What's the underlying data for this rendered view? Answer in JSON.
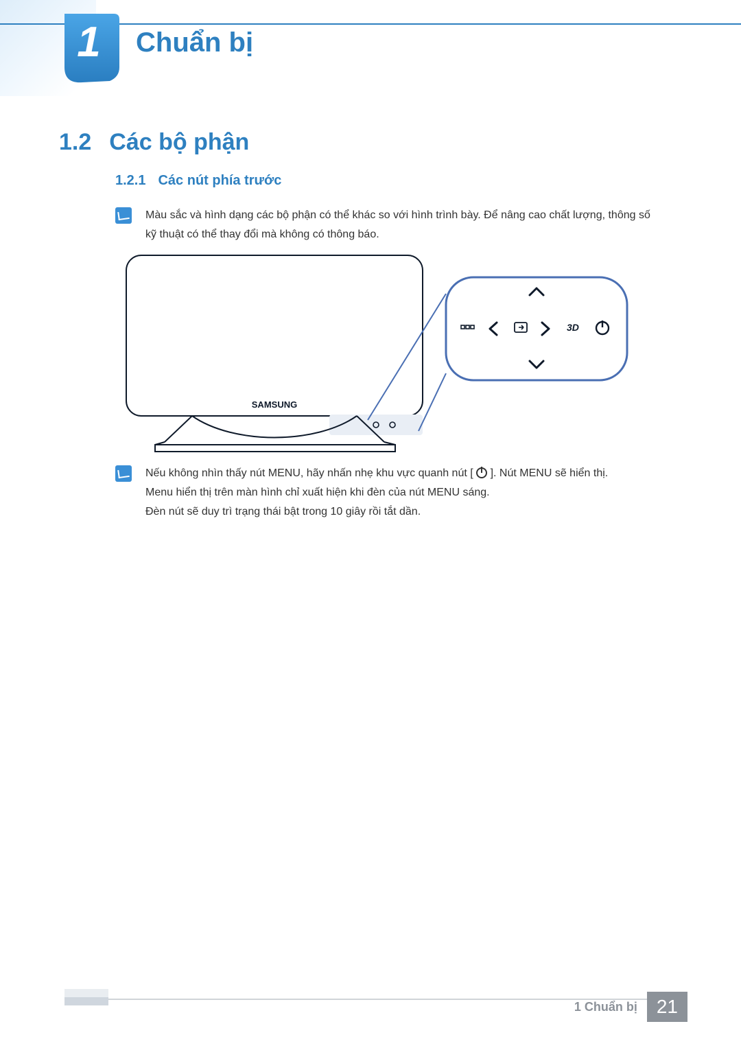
{
  "chapter": {
    "number": "1",
    "title": "Chuẩn bị"
  },
  "section": {
    "number": "1.2",
    "title": "Các bộ phận"
  },
  "subsection": {
    "number": "1.2.1",
    "title": "Các nút phía trước"
  },
  "notes": {
    "note1": "Màu sắc và hình dạng các bộ phận có thể khác so với hình trình bày. Để nâng cao chất lượng, thông số kỹ thuật có thể thay đổi mà không có thông báo.",
    "note2_line1_a": "Nếu không nhìn thấy nút MENU, hãy nhấn nhẹ khu vực quanh nút [",
    "note2_line1_b": "]. Nút MENU sẽ hiển thị.",
    "note2_line2": "Menu hiển thị trên màn hình chỉ xuất hiện khi đèn của nút MENU sáng.",
    "note2_line3": "Đèn nút sẽ duy trì trạng thái bật trong 10 giây rồi tắt dần."
  },
  "device": {
    "brand": "SAMSUNG"
  },
  "callout_buttons": {
    "menu": "menu-icon",
    "left": "chevron-left-icon",
    "source": "source-icon",
    "right": "chevron-right-icon",
    "three_d": "3D",
    "power": "power-icon",
    "up": "chevron-up-icon",
    "down": "chevron-down-icon"
  },
  "footer": {
    "chapter_label": "1 Chuẩn bị",
    "page": "21"
  }
}
